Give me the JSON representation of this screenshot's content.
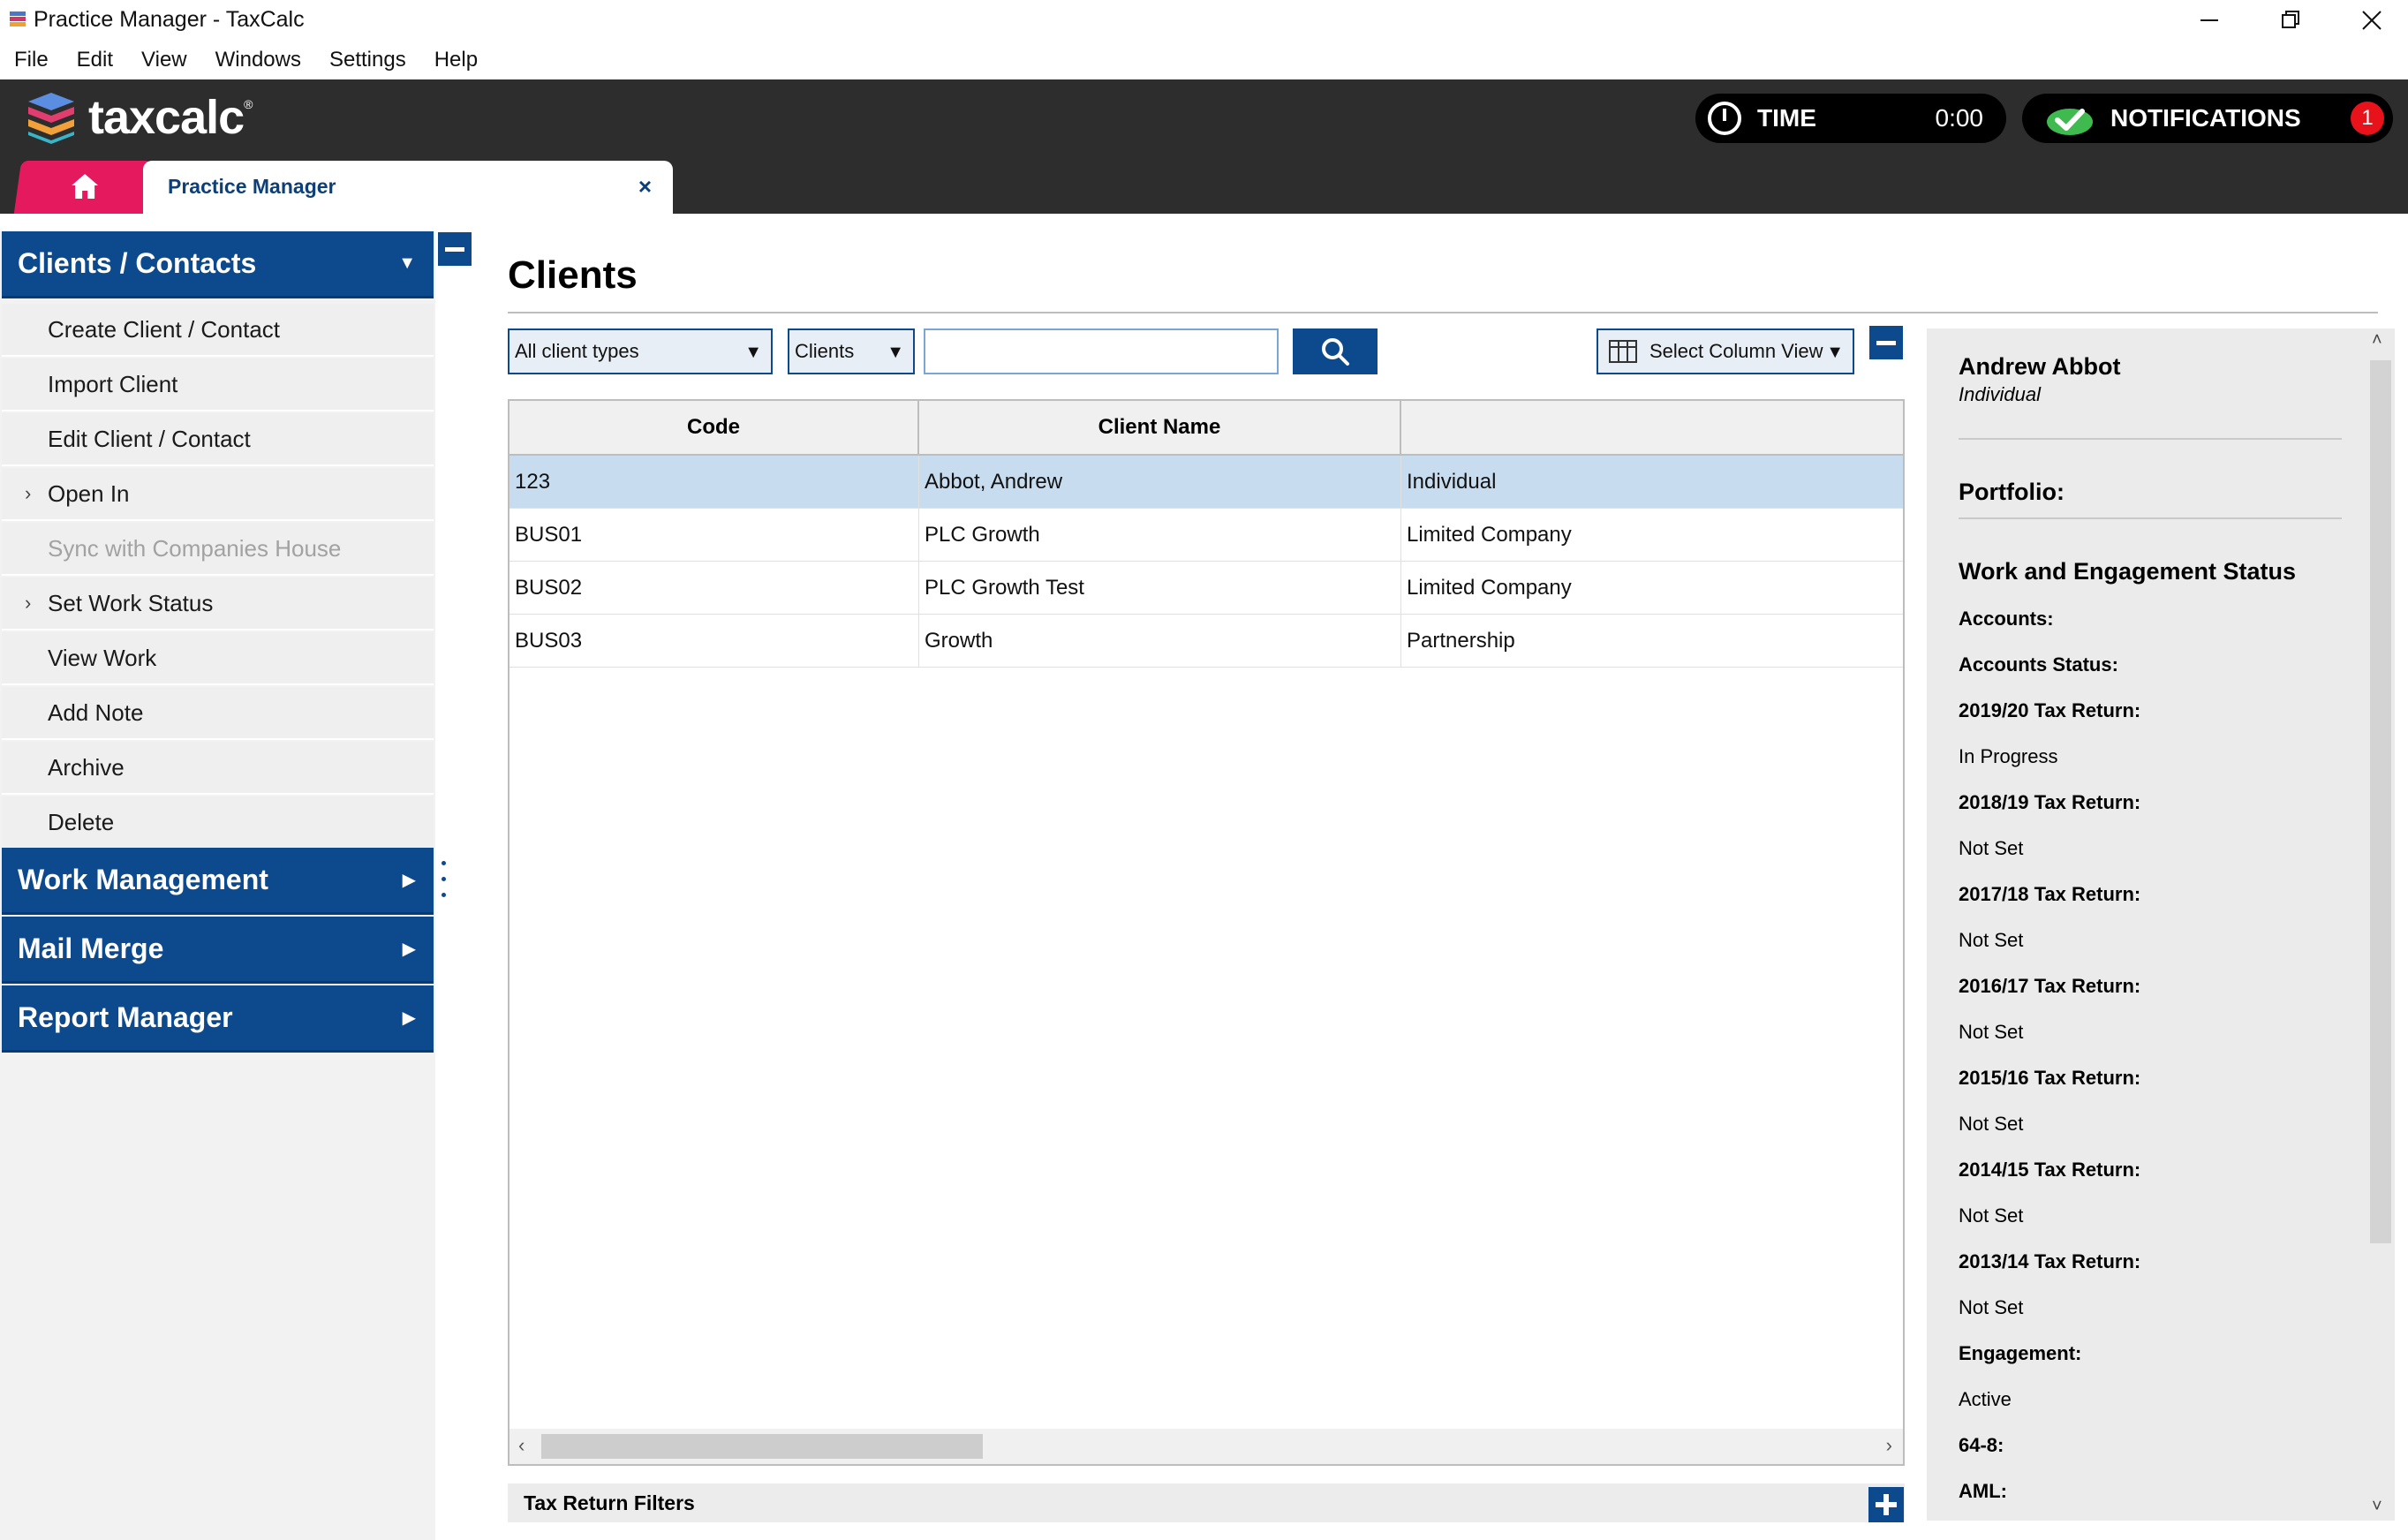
{
  "window": {
    "title": "Practice Manager - TaxCalc",
    "controls": [
      "minimize",
      "restore",
      "close"
    ]
  },
  "menu": [
    "File",
    "Edit",
    "View",
    "Windows",
    "Settings",
    "Help"
  ],
  "header": {
    "logo_text": "taxcalc",
    "time_label": "TIME",
    "time_value": "0:00",
    "notifications_label": "NOTIFICATIONS",
    "notifications_count": "1",
    "tab_label": "Practice Manager",
    "tab_close": "×"
  },
  "sidebar": {
    "clients_header": "Clients / Contacts",
    "items": [
      {
        "label": "Create Client / Contact",
        "chevron": false,
        "disabled": false
      },
      {
        "label": "Import Client",
        "chevron": false,
        "disabled": false
      },
      {
        "label": "Edit Client / Contact",
        "chevron": false,
        "disabled": false
      },
      {
        "label": "Open In",
        "chevron": true,
        "disabled": false
      },
      {
        "label": "Sync with Companies House",
        "chevron": false,
        "disabled": true
      },
      {
        "label": "Set Work Status",
        "chevron": true,
        "disabled": false
      },
      {
        "label": "View Work",
        "chevron": false,
        "disabled": false
      },
      {
        "label": "Add Note",
        "chevron": false,
        "disabled": false
      },
      {
        "label": "Archive",
        "chevron": false,
        "disabled": false
      },
      {
        "label": "Delete",
        "chevron": false,
        "disabled": false
      }
    ],
    "sections": [
      "Work Management",
      "Mail Merge",
      "Report Manager"
    ]
  },
  "main": {
    "title": "Clients",
    "filter_type": "All client types",
    "filter_kind": "Clients",
    "search_value": "",
    "column_view_label": "Select Column View",
    "columns": [
      "Code",
      "Client Name",
      ""
    ],
    "rows": [
      [
        "123",
        "Abbot, Andrew",
        "Individual"
      ],
      [
        "BUS01",
        "PLC Growth",
        "Limited Company"
      ],
      [
        "BUS02",
        "PLC Growth Test",
        "Limited Company"
      ],
      [
        "BUS03",
        "Growth",
        "Partnership"
      ]
    ],
    "selected_row": 0,
    "tax_return_filters": "Tax Return Filters"
  },
  "details": {
    "name": "Andrew Abbot",
    "type": "Individual",
    "portfolio_label": "Portfolio:",
    "status_heading": "Work and Engagement Status",
    "fields": [
      {
        "label": "Accounts:",
        "value": ""
      },
      {
        "label": "Accounts Status:",
        "value": ""
      },
      {
        "label": "2019/20 Tax Return:",
        "value": "In Progress"
      },
      {
        "label": "2018/19 Tax Return:",
        "value": "Not Set"
      },
      {
        "label": "2017/18 Tax Return:",
        "value": "Not Set"
      },
      {
        "label": "2016/17 Tax Return:",
        "value": "Not Set"
      },
      {
        "label": "2015/16 Tax Return:",
        "value": "Not Set"
      },
      {
        "label": "2014/15 Tax Return:",
        "value": "Not Set"
      },
      {
        "label": "2013/14 Tax Return:",
        "value": "Not Set"
      },
      {
        "label": "Engagement:",
        "value": "Active"
      },
      {
        "label": "64-8:",
        "value": ""
      },
      {
        "label": "AML:",
        "value": ""
      }
    ]
  },
  "colors": {
    "accent": "#0d4a8d",
    "header_bg": "#2d2d2d",
    "home_tab": "#e5195e",
    "selected_row": "#c8dcef",
    "badge": "#e8121a",
    "check": "#3fba4f"
  }
}
